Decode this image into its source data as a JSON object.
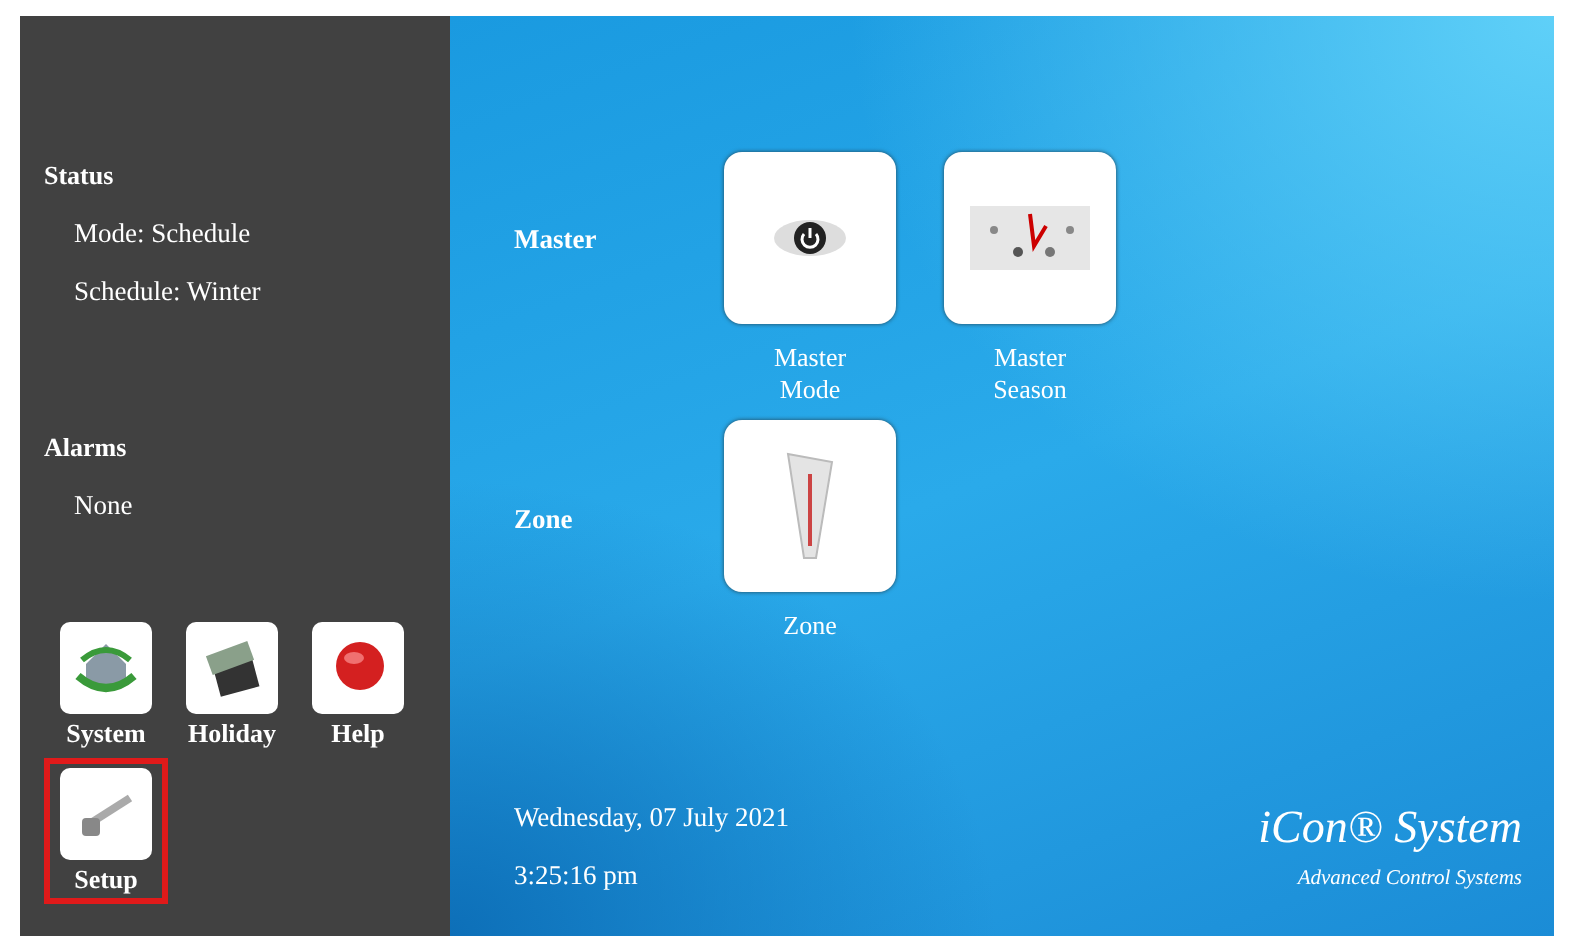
{
  "status": {
    "title": "Status",
    "lines": [
      "Mode: Schedule",
      "Schedule: Winter"
    ]
  },
  "alarms": {
    "title": "Alarms",
    "lines": [
      "None"
    ]
  },
  "sidebar_buttons": [
    {
      "label": "System",
      "kind": "system",
      "selected": false
    },
    {
      "label": "Holiday",
      "kind": "holiday",
      "selected": false
    },
    {
      "label": "Help",
      "kind": "help",
      "selected": false
    },
    {
      "label": "Setup",
      "kind": "setup",
      "selected": true
    }
  ],
  "groups": [
    {
      "label": "Master",
      "tiles": [
        {
          "label": "Master Mode",
          "kind": "power"
        },
        {
          "label": "Master Season",
          "kind": "clock"
        }
      ]
    },
    {
      "label": "Zone",
      "tiles": [
        {
          "label": "Zone",
          "kind": "thermometer"
        }
      ]
    }
  ],
  "date": "Wednesday, 07 July 2021",
  "time": "3:25:16 pm",
  "brand": {
    "name": "iCon® System",
    "tagline": "Advanced Control Systems"
  }
}
